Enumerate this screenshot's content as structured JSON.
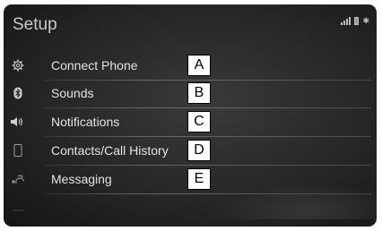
{
  "header": {
    "title": "Setup"
  },
  "menu": {
    "items": [
      {
        "label": "Connect Phone",
        "icon": "gear-icon",
        "callout": "A"
      },
      {
        "label": "Sounds",
        "icon": "bluetooth-icon",
        "callout": "B"
      },
      {
        "label": "Notifications",
        "icon": "speaker-icon",
        "callout": "C"
      },
      {
        "label": "Contacts/Call History",
        "icon": "phone-icon",
        "callout": "D"
      },
      {
        "label": "Messaging",
        "icon": "message-icon",
        "callout": "E"
      }
    ]
  },
  "colors": {
    "background": "#262626",
    "text": "#e3e3e3"
  }
}
